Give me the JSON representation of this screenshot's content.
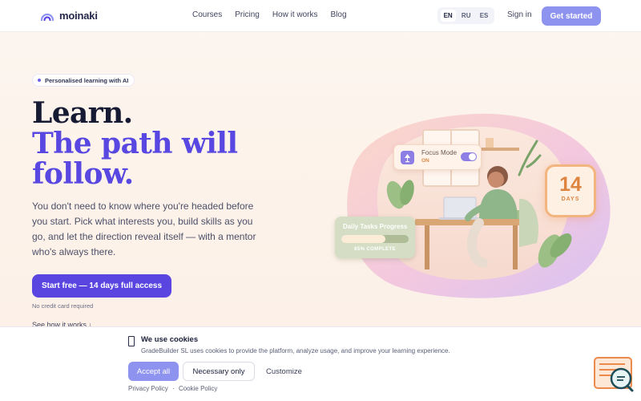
{
  "nav": {
    "logo_text": "moinaki",
    "links": [
      "Courses",
      "Pricing",
      "How it works",
      "Blog"
    ],
    "languages": [
      "EN",
      "RU",
      "ES"
    ],
    "active_language": "EN",
    "signin": "Sign in",
    "cta": "Get started"
  },
  "hero": {
    "badge": "Personalised learning with AI",
    "headline_line1": "Learn.",
    "headline_line2": "The path will",
    "headline_line3": "follow.",
    "description": "You don't need to know where you're headed before you start. Pick what interests you, build skills as you go, and let the direction reveal itself — with a mentor who's always there.",
    "cta": "Start free — 14 days full access",
    "note": "No credit card required",
    "see_how": "See how it works ↓"
  },
  "illustration": {
    "focus_mode": {
      "title": "Focus Mode",
      "status": "ON"
    },
    "days": {
      "number": "14",
      "label": "DAYS"
    },
    "tasks": {
      "title": "Daily Tasks Progress",
      "percent_label": "65% COMPLETE",
      "progress": 0.65
    }
  },
  "cookie": {
    "title": "We use cookies",
    "description": "GradeBuilder SL uses cookies to provide the platform, analyze usage, and improve your learning experience.",
    "accept": "Accept all",
    "necessary": "Necessary only",
    "customize": "Customize",
    "privacy": "Privacy Policy",
    "separator": "·",
    "cookie_policy": "Cookie Policy"
  },
  "colors": {
    "accent": "#5a45e1",
    "accent_soft": "#8f93f0",
    "headline_dark": "#171a33",
    "orange": "#dd8540"
  },
  "icons": [
    "logo-arc-icon",
    "lamp-icon",
    "cookie-doc-icon",
    "help-chat-icon"
  ]
}
